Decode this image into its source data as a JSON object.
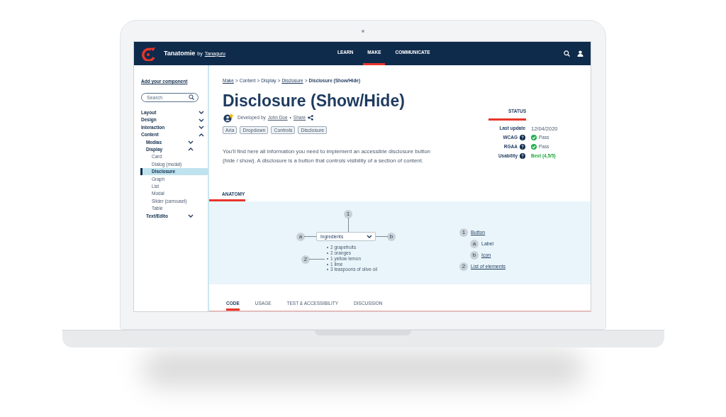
{
  "header": {
    "brand": "Tanatomie",
    "by": "by",
    "publisher": "Tanaguru",
    "nav": [
      {
        "label": "LEARN",
        "selected": false
      },
      {
        "label": "MAKE",
        "selected": true
      },
      {
        "label": "COMMUNICATE",
        "selected": false
      }
    ]
  },
  "sidebar": {
    "add_link": "Add your component",
    "search": {
      "placeholder": "Search"
    },
    "items": [
      {
        "label": "Layout",
        "expanded": false
      },
      {
        "label": "Design",
        "expanded": false
      },
      {
        "label": "Interaction",
        "expanded": false
      },
      {
        "label": "Content",
        "expanded": true,
        "children": [
          {
            "label": "Medias",
            "expanded": false
          },
          {
            "label": "Display",
            "expanded": true,
            "children": [
              {
                "label": "Card",
                "selected": false
              },
              {
                "label": "Dialog (modal)",
                "selected": false
              },
              {
                "label": "Disclosure",
                "selected": true
              },
              {
                "label": "Graph",
                "selected": false
              },
              {
                "label": "List",
                "selected": false
              },
              {
                "label": "Modal",
                "selected": false
              },
              {
                "label": "Slider (carrousel)",
                "selected": false
              },
              {
                "label": "Table",
                "selected": false
              }
            ]
          },
          {
            "label": "Text/Edito",
            "expanded": false
          }
        ]
      }
    ]
  },
  "breadcrumbs": [
    {
      "label": "Make",
      "kind": "link"
    },
    {
      "label": ">",
      "kind": "separator"
    },
    {
      "label": "Content",
      "kind": "text"
    },
    {
      "label": ">",
      "kind": "separator"
    },
    {
      "label": "Display",
      "kind": "text"
    },
    {
      "label": ">",
      "kind": "separator"
    },
    {
      "label": "Disclosure",
      "kind": "link"
    },
    {
      "label": ">",
      "kind": "separator"
    },
    {
      "label": "Disclosure (Show/Hide)",
      "kind": "current"
    }
  ],
  "title": "Disclosure (Show/Hide)",
  "author": {
    "prefix": "Developed by",
    "name": "John Doe",
    "dot": "•",
    "share": "Share"
  },
  "tags": [
    "Aria",
    "Dropdown",
    "Controls",
    "Disclosure"
  ],
  "description": "You'll find here all information you need to implement an accessible disclosure button (hide / show). A disclosure is a button that controls visibility of a section of content.",
  "status": {
    "heading": "STATUS",
    "rows": [
      {
        "label": "Last update",
        "kind": "date",
        "value": "12/04/2020"
      },
      {
        "label": "WCAG",
        "kind": "pass",
        "value": "Pass"
      },
      {
        "label": "RGAA",
        "kind": "pass",
        "value": "Pass"
      },
      {
        "label": "Usability",
        "kind": "rating",
        "value": "Best (4,5/5)"
      }
    ]
  },
  "anatomy_tab": {
    "label": "ANATOMY",
    "selected": true
  },
  "diagram": {
    "button_marker": "1",
    "label_marker": "a",
    "icon_marker": "b",
    "list_marker": "2",
    "button_label": "Ingredients",
    "list": [
      "2 grapefruits",
      "2 oranges",
      "1 yellow lemon",
      "1 lime",
      "3 teaspoons of olive oil"
    ]
  },
  "legend": [
    {
      "marker": "1",
      "label": "Button",
      "link": true,
      "children": [
        {
          "marker": "a",
          "label": "Label",
          "link": false
        },
        {
          "marker": "b",
          "label": "Icon",
          "link": true
        }
      ]
    },
    {
      "marker": "2",
      "label": "List of elements",
      "link": true
    }
  ],
  "tabs": [
    {
      "label": "CODE",
      "selected": true
    },
    {
      "label": "USAGE",
      "selected": false
    },
    {
      "label": "TEST & ACCESSIBILITY",
      "selected": false
    },
    {
      "label": "DISCUSSION",
      "selected": false
    }
  ]
}
